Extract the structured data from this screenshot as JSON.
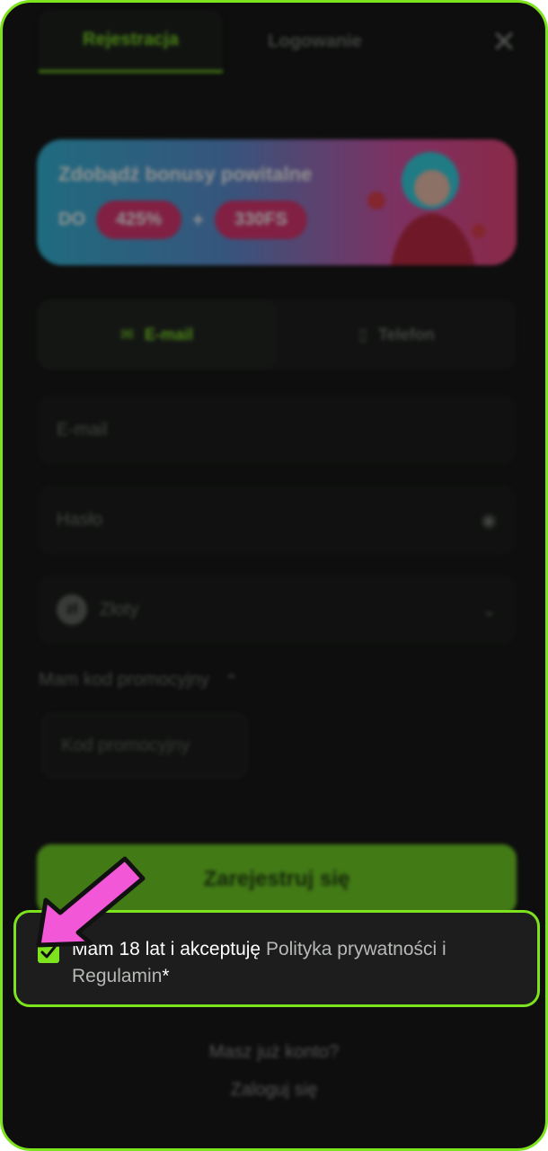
{
  "tabs": [
    {
      "label": "Rejestracja",
      "active": true
    },
    {
      "label": "Logowanie",
      "active": false
    }
  ],
  "banner": {
    "title": "Zdobądź bonusy powitalne",
    "prefix": "DO",
    "bonus_percent": "425%",
    "plus": "+",
    "bonus_fs": "330FS"
  },
  "method": {
    "email_label": "E-mail",
    "phone_label": "Telefon"
  },
  "fields": {
    "email_placeholder": "E-mail",
    "password_placeholder": "Hasło",
    "currency_value": "Złoty",
    "currency_symbol": "zł"
  },
  "promo": {
    "toggle_label": "Mam kod promocyjny",
    "placeholder": "Kod promocyjny"
  },
  "register_button": "Zarejestruj się",
  "consent": {
    "checked": true,
    "text_before": "Mam 18 lat i akceptuję ",
    "privacy_link": "Polityka prywatności",
    "and": " i ",
    "terms_link": "Regulamin",
    "asterisk": "*"
  },
  "footer": {
    "have_account": "Masz już konto?",
    "login_link": "Zaloguj się"
  },
  "colors": {
    "accent": "#7ee31f",
    "background": "#0d0e0d",
    "arrow": "#f257d8",
    "banner_pill": "#e0306f"
  }
}
